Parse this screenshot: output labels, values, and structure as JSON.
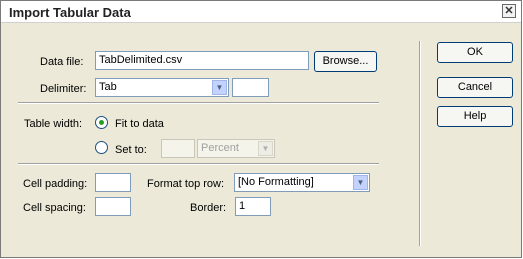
{
  "window": {
    "title": "Import Tabular Data",
    "close_glyph": "✕"
  },
  "data_file": {
    "label": "Data file:",
    "value": "TabDelimited.csv",
    "browse_label": "Browse..."
  },
  "delimiter": {
    "label": "Delimiter:",
    "selected": "Tab",
    "other_value": ""
  },
  "table_width": {
    "label": "Table width:",
    "fit_label": "Fit to data",
    "set_label": "Set to:",
    "set_value": "",
    "unit_selected": "Percent",
    "selected_option": "Fit to data"
  },
  "cell_padding": {
    "label": "Cell padding:",
    "value": ""
  },
  "cell_spacing": {
    "label": "Cell spacing:",
    "value": ""
  },
  "format_top_row": {
    "label": "Format top row:",
    "selected": "[No Formatting]"
  },
  "border": {
    "label": "Border:",
    "value": "1"
  },
  "buttons": {
    "ok": "OK",
    "cancel": "Cancel",
    "help": "Help"
  }
}
